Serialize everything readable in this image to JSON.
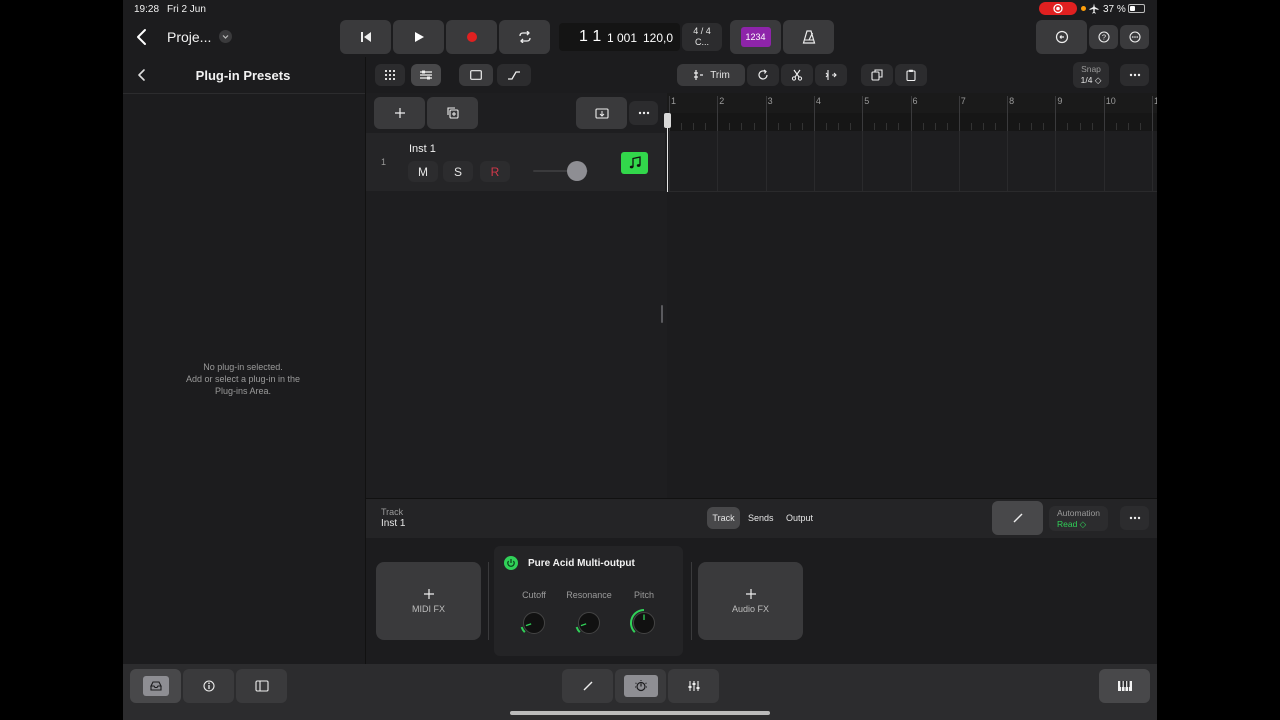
{
  "status_bar": {
    "time": "19:28",
    "date": "Fri 2 Jun",
    "battery": "37 %"
  },
  "header": {
    "project_name": "Proje...",
    "position": "1  1",
    "ticks": "1 001",
    "tempo": "120,0",
    "time_signature": "4 / 4",
    "key": "C...",
    "count_in_label": "1234"
  },
  "left_panel": {
    "title": "Plug-in Presets",
    "empty_line1": "No plug-in selected.",
    "empty_line2": "Add or select a plug-in in the",
    "empty_line3": "Plug-ins Area."
  },
  "toolbar": {
    "trim_label": "Trim",
    "snap_label": "Snap",
    "snap_value": "1/4 ◇"
  },
  "ruler": {
    "bars": [
      "1",
      "2",
      "3",
      "4",
      "5",
      "6",
      "7",
      "8",
      "9",
      "10",
      "1"
    ]
  },
  "track": {
    "number": "1",
    "name": "Inst 1",
    "mute": "M",
    "solo": "S",
    "record": "R"
  },
  "inspector": {
    "track_label": "Track",
    "track_name": "Inst 1",
    "tabs": [
      "Track",
      "Sends",
      "Output"
    ],
    "automation_label": "Automation",
    "automation_value": "Read ◇"
  },
  "plugins": {
    "midi_fx_label": "MIDI FX",
    "audio_fx_label": "Audio FX",
    "instrument_name": "Pure Acid Multi-output",
    "knobs": [
      {
        "label": "Cutoff",
        "value": 0.1
      },
      {
        "label": "Resonance",
        "value": 0.1
      },
      {
        "label": "Pitch",
        "value": 0.5
      }
    ]
  },
  "colors": {
    "accent_green": "#30d158",
    "region_green": "#32d74b",
    "record_red": "#e02020",
    "count_in_purple": "#8e24aa",
    "automation_green": "#30d158"
  }
}
